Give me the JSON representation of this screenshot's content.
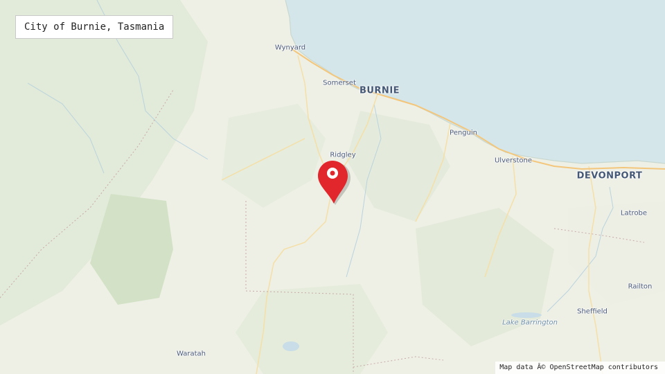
{
  "title": "City of Burnie, Tasmania",
  "places": {
    "wynyard": "Wynyard",
    "somerset": "Somerset",
    "burnie": "BURNIE",
    "ridgley": "Ridgley",
    "penguin": "Penguin",
    "ulverstone": "Ulverstone",
    "devonport": "DEVONPORT",
    "latrobe": "Latrobe",
    "railton": "Railton",
    "sheffield": "Sheffield",
    "lake_barrington": "Lake Barrington",
    "waratah": "Waratah"
  },
  "attribution": "Map data Â© OpenStreetMap contributors",
  "colors": {
    "sea": "#d4e6ea",
    "land": "#eef0e6",
    "forest": "#dde8d3",
    "marker": "#e1262c"
  }
}
